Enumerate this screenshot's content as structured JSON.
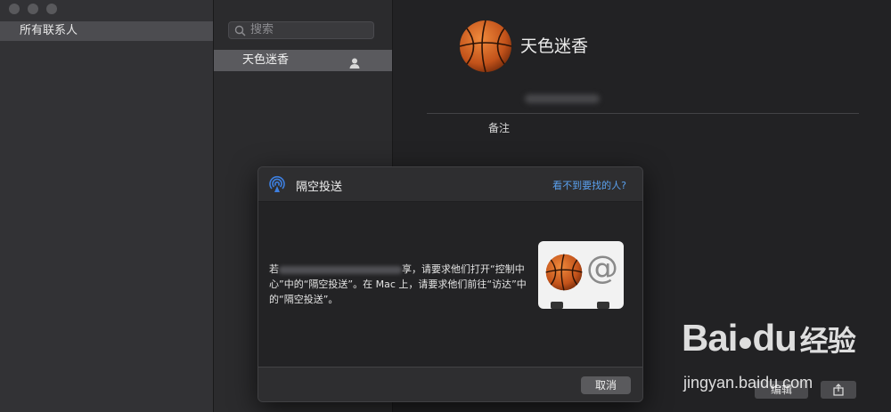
{
  "window": {
    "traffic_lights": [
      "close",
      "minimize",
      "zoom"
    ]
  },
  "sidebar": {
    "items": [
      {
        "label": "所有联系人",
        "selected": true
      }
    ]
  },
  "contact_list": {
    "search_placeholder": "搜索",
    "contacts": [
      {
        "name": "天色迷香",
        "icon": "person-icon",
        "selected": true
      }
    ]
  },
  "detail": {
    "name": "天色迷香",
    "avatar": "basketball-avatar",
    "notes_label": "备注",
    "edit_label": "编辑",
    "share_icon": "share-icon"
  },
  "dialog": {
    "title": "隔空投送",
    "help_link": "看不到要找的人?",
    "body_start": "若",
    "body_rest": "享，请要求他们打开“控制中心”中的“隔空投送”。在 Mac 上，请要求他们前往“访达”中的“隔空投送”。",
    "cancel_label": "取消",
    "icon": "airdrop-icon"
  },
  "watermark": {
    "brand": "Bai",
    "brand_du": "du",
    "brand_cn": "经验",
    "url": "jingyan.baidu.com"
  },
  "colors": {
    "link": "#5aa0ee",
    "selected_row": "#5a5a5e"
  }
}
